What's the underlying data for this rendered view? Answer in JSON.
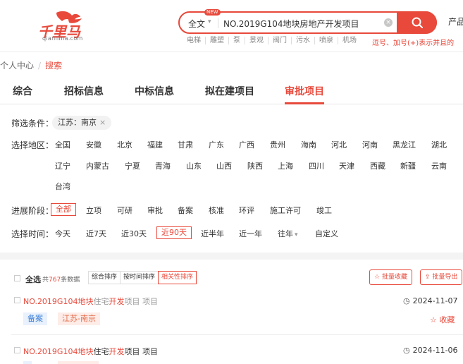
{
  "header": {
    "logo_text": "千里马",
    "logo_domain": "qianlima.com",
    "search": {
      "scope": "全文",
      "new_badge": "NEW",
      "query": "NO.2019G104地块房地产开发项目"
    },
    "hot_tags": [
      "电梯",
      "雕塑",
      "泵",
      "景观",
      "阀门",
      "污水",
      "喷泉",
      "机场"
    ],
    "hint": "逗号、加号(+)表示并且的",
    "product_link": "产品"
  },
  "breadcrumb": {
    "parent": "个人中心",
    "current": "搜索"
  },
  "tabs": [
    "综合",
    "招标信息",
    "中标信息",
    "拟在建项目",
    "审批项目"
  ],
  "active_tab": "审批项目",
  "filters": {
    "condition_label": "筛选条件：",
    "condition_chip": "江苏：南京",
    "region_label": "选择地区：",
    "regions_row1": [
      "全国",
      "安徽",
      "北京",
      "福建",
      "甘肃",
      "广东",
      "广西",
      "贵州",
      "海南",
      "河北",
      "河南",
      "黑龙江",
      "湖北"
    ],
    "regions_row2": [
      "辽宁",
      "内蒙古",
      "宁夏",
      "青海",
      "山东",
      "山西",
      "陕西",
      "上海",
      "四川",
      "天津",
      "西藏",
      "新疆",
      "云南"
    ],
    "regions_row3": [
      "台湾"
    ],
    "stage_label": "进展阶段：",
    "stages": [
      "全部",
      "立项",
      "可研",
      "审批",
      "备案",
      "核准",
      "环评",
      "施工许可",
      "竣工"
    ],
    "active_stage": "全部",
    "time_label": "选择时间：",
    "times": [
      "今天",
      "近7天",
      "近30天",
      "近90天",
      "近半年",
      "近一年",
      "往年",
      "自定义"
    ],
    "active_time": "近90天"
  },
  "list_toolbar": {
    "select_all": "全选",
    "total_prefix": "共",
    "total_count": "767",
    "total_suffix": "条数据",
    "sort_options": [
      "综合排序",
      "按时间排序",
      "相关性排序"
    ],
    "active_sort": "相关性排序",
    "batch_fav": "批量收藏",
    "batch_export": "批量导出"
  },
  "results": [
    {
      "title_hl1": "NO.2019G104地块",
      "title_mid": "住宅",
      "title_hl2": "开发",
      "title_rest": "项目 项目",
      "date": "2024-11-07",
      "stage_badge": "备案",
      "region_badge": "江苏-南京",
      "fav_label": "收藏"
    },
    {
      "title_hl1": "NO.2019G104地块",
      "title_mid": "住宅",
      "title_hl2": "开发",
      "title_rest": "项目 项目",
      "date": "2024-11-06"
    }
  ],
  "colors": {
    "accent": "#e8493b",
    "badge_blue": "#3d7fd6",
    "badge_orange": "#e36d4b"
  }
}
